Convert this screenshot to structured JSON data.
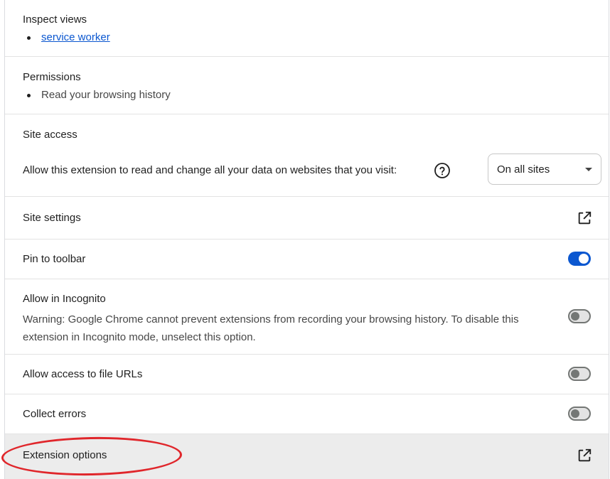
{
  "inspect_views": {
    "title": "Inspect views",
    "links": [
      "service worker"
    ]
  },
  "permissions": {
    "title": "Permissions",
    "items": [
      "Read your browsing history"
    ]
  },
  "site_access": {
    "title": "Site access",
    "description": "Allow this extension to read and change all your data on websites that you visit:",
    "help_icon": "help-circle-icon",
    "dropdown_value": "On all sites"
  },
  "site_settings": {
    "label": "Site settings",
    "icon": "open-in-new-icon"
  },
  "pin_to_toolbar": {
    "label": "Pin to toolbar",
    "enabled": true
  },
  "allow_incognito": {
    "label": "Allow in Incognito",
    "warning": "Warning: Google Chrome cannot prevent extensions from recording your browsing history. To disable this extension in Incognito mode, unselect this option.",
    "enabled": false
  },
  "allow_file_urls": {
    "label": "Allow access to file URLs",
    "enabled": false
  },
  "collect_errors": {
    "label": "Collect errors",
    "enabled": false
  },
  "extension_options": {
    "label": "Extension options",
    "icon": "open-in-new-icon"
  },
  "colors": {
    "accent": "#0b57d0",
    "annotation": "#e0262b",
    "highlight_bg": "#ececec"
  }
}
